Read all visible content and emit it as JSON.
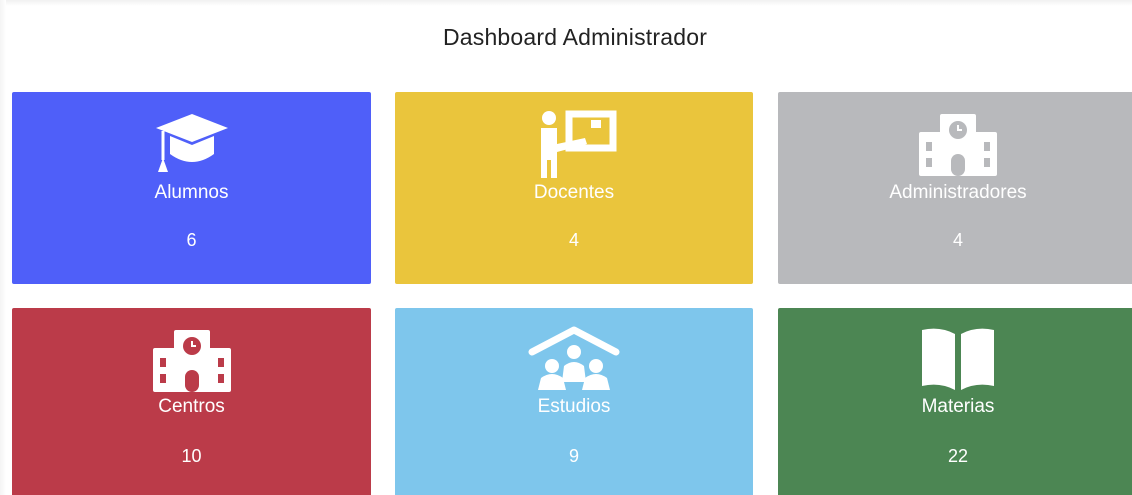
{
  "dashboard": {
    "title": "Dashboard Administrador"
  },
  "cards": [
    {
      "label": "Alumnos",
      "count": "6",
      "icon": "graduation-cap-icon",
      "color": "#4f5ff9"
    },
    {
      "label": "Docentes",
      "count": "4",
      "icon": "teacher-board-icon",
      "color": "#eac53c"
    },
    {
      "label": "Administradores",
      "count": "4",
      "icon": "school-building-icon",
      "color": "#b8b9bc"
    },
    {
      "label": "Centros",
      "count": "10",
      "icon": "school-building-icon",
      "color": "#bb3b49"
    },
    {
      "label": "Estudios",
      "count": "9",
      "icon": "people-roof-icon",
      "color": "#7ec6ec"
    },
    {
      "label": "Materias",
      "count": "22",
      "icon": "open-book-icon",
      "color": "#4c8653"
    }
  ]
}
